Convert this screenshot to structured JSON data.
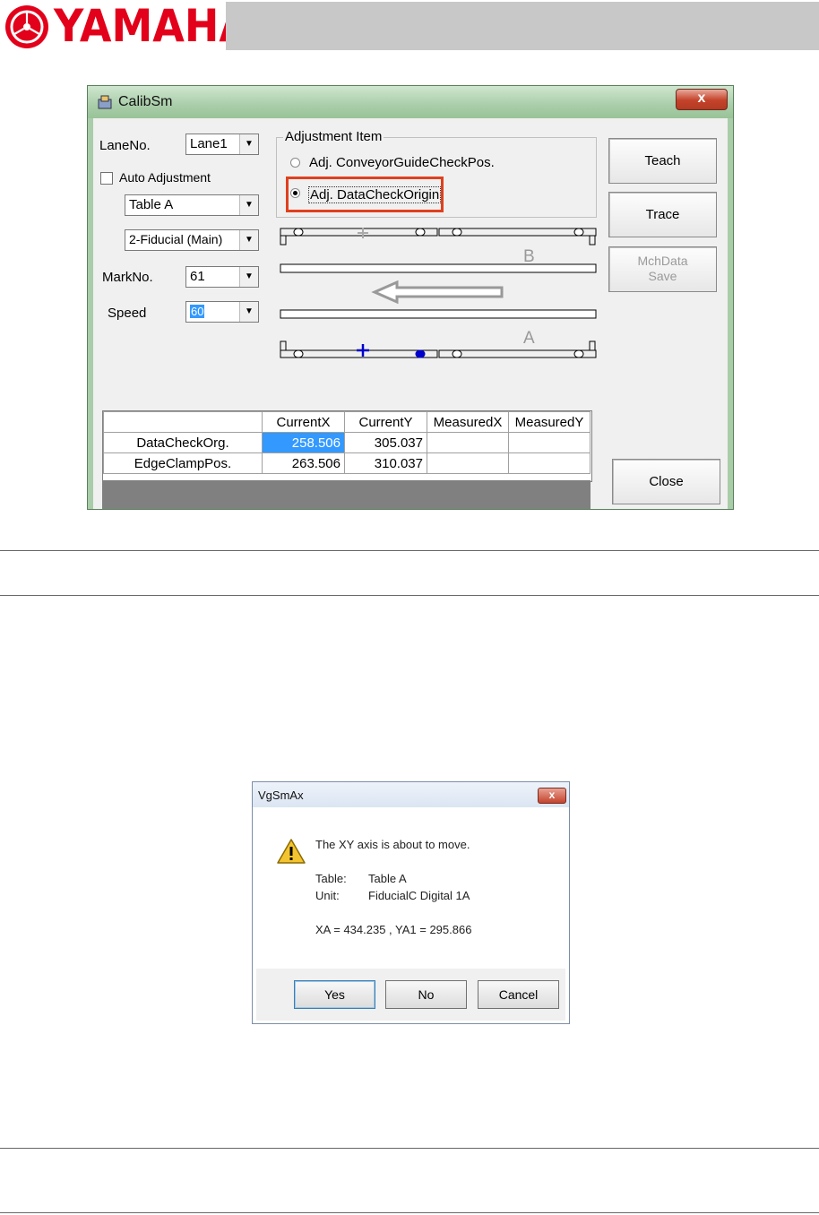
{
  "header": {
    "brand": "YAMAHA",
    "accent": "#e2001a"
  },
  "calib": {
    "title": "CalibSm",
    "close_glyph": "x",
    "lane_label": "LaneNo.",
    "lane_value": "Lane1",
    "auto_adjust_label": "Auto Adjustment",
    "auto_adjust_checked": false,
    "table_value": "Table A",
    "fiducial_value": "2-Fiducial (Main)",
    "mark_label": "MarkNo.",
    "mark_value": "61",
    "speed_label": "Speed",
    "speed_value": "60",
    "group_title": "Adjustment Item",
    "radio1_label": "Adj. ConveyorGuideCheckPos.",
    "radio2_label": "Adj. DataCheckOrigin",
    "selected_radio": 2,
    "teach_label": "Teach",
    "trace_label": "Trace",
    "mchdata_label_1": "MchData",
    "mchdata_label_2": "Save",
    "close_label": "Close",
    "conveyor_b_label": "B",
    "conveyor_a_label": "A",
    "grid": {
      "headers": [
        "",
        "CurrentX",
        "CurrentY",
        "MeasuredX",
        "MeasuredY"
      ],
      "rows": [
        {
          "name": "DataCheckOrg.",
          "cx": "258.506",
          "cy": "305.037",
          "mx": "",
          "my": ""
        },
        {
          "name": "EdgeClampPos.",
          "cx": "263.506",
          "cy": "310.037",
          "mx": "",
          "my": ""
        }
      ],
      "selected_color": "#3399ff"
    },
    "highlight_color": "#e0401e"
  },
  "dialog": {
    "title": "VgSmAx",
    "close_glyph": "x",
    "message": "The XY axis is about to move.",
    "table_label": "Table:",
    "table_value": "Table A",
    "unit_label": "Unit:",
    "unit_value": "FiducialC Digital 1A",
    "coords": "XA = 434.235 , YA1 = 295.866",
    "yes_label": "Yes",
    "no_label": "No",
    "cancel_label": "Cancel"
  }
}
